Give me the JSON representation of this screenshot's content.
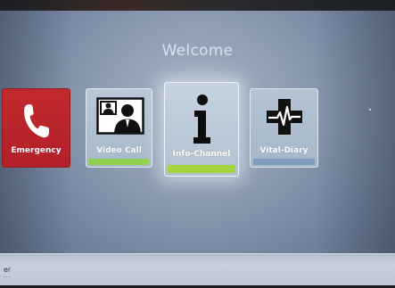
{
  "screen": {
    "welcome": "Welcome"
  },
  "tiles": [
    {
      "id": "emergency",
      "label": "Emergency",
      "icon": "phone-icon",
      "bar_color": ""
    },
    {
      "id": "video-call",
      "label": "Video Call",
      "icon": "video-call-icon",
      "bar_color": "#8fd14f"
    },
    {
      "id": "info-channel",
      "label": "Info-Channel",
      "icon": "info-icon",
      "bar_color": "#a6d43f"
    },
    {
      "id": "vital-diary",
      "label": "Vital-Diary",
      "icon": "heart-pulse-cross-icon",
      "bar_color": "#7f9bbd"
    }
  ],
  "bottom": {
    "text": "er",
    "subtext": "··· ··"
  },
  "colors": {
    "emergency": "#b3202a",
    "tile": "#aebfd0",
    "icon": "#111111",
    "screen": "#8d9cb2"
  }
}
